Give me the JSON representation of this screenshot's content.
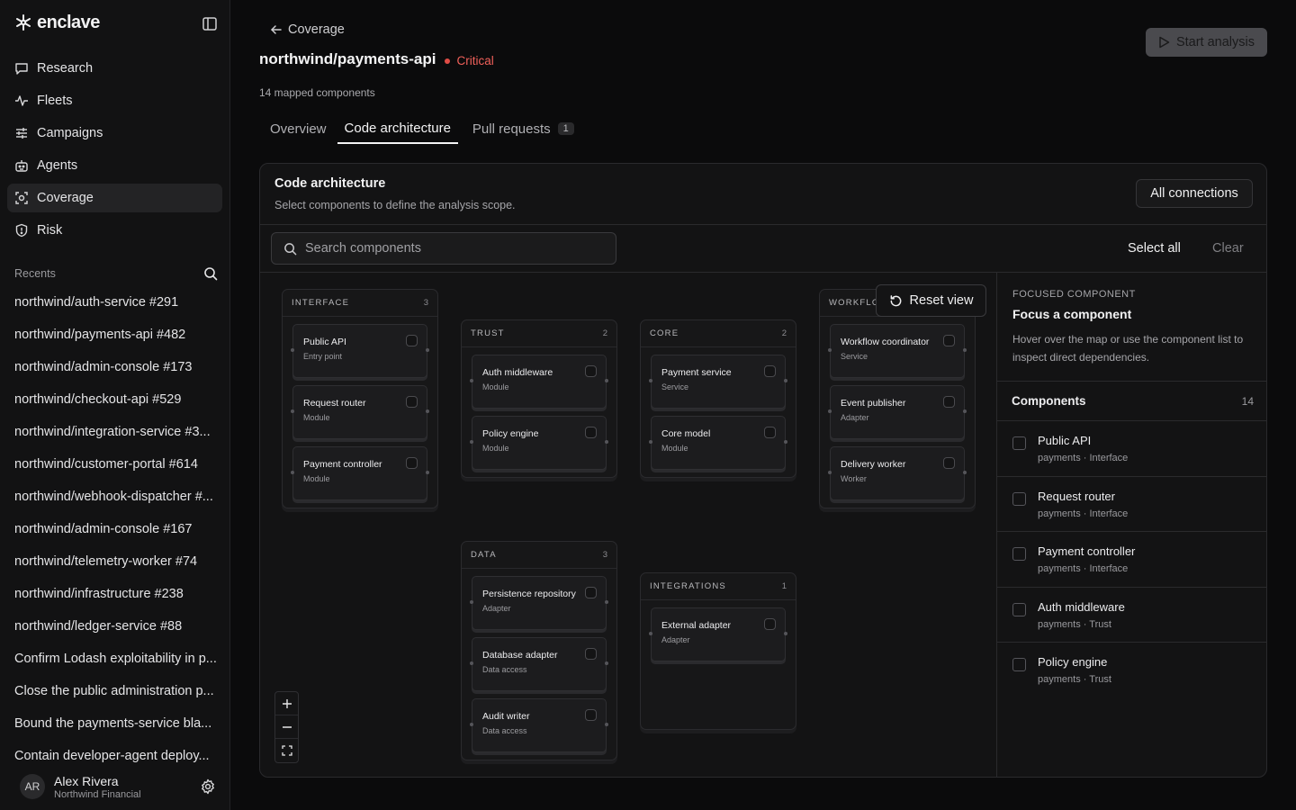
{
  "app": {
    "name": "enclave"
  },
  "nav": [
    {
      "label": "Research",
      "icon": "chat-bubble-icon"
    },
    {
      "label": "Fleets",
      "icon": "activity-icon"
    },
    {
      "label": "Campaigns",
      "icon": "sliders-icon"
    },
    {
      "label": "Agents",
      "icon": "robot-icon"
    },
    {
      "label": "Coverage",
      "icon": "scan-icon",
      "active": true
    },
    {
      "label": "Risk",
      "icon": "shield-icon"
    }
  ],
  "recents": {
    "label": "Recents",
    "items": [
      "northwind/auth-service #291",
      "northwind/payments-api #482",
      "northwind/admin-console #173",
      "northwind/checkout-api #529",
      "northwind/integration-service #3...",
      "northwind/customer-portal #614",
      "northwind/webhook-dispatcher #...",
      "northwind/admin-console #167",
      "northwind/telemetry-worker #74",
      "northwind/infrastructure #238",
      "northwind/ledger-service #88",
      "Confirm Lodash exploitability in p...",
      "Close the public administration p...",
      "Bound the payments-service bla...",
      "Contain developer-agent deploy..."
    ]
  },
  "user": {
    "initials": "AR",
    "name": "Alex Rivera",
    "org": "Northwind Financial"
  },
  "header": {
    "back_label": "Coverage",
    "repo": "northwind/payments-api",
    "severity": "Critical",
    "mapped": "14 mapped components",
    "start_button": "Start analysis"
  },
  "tabs": [
    {
      "label": "Overview"
    },
    {
      "label": "Code architecture",
      "active": true
    },
    {
      "label": "Pull requests",
      "badge": "1"
    }
  ],
  "panel": {
    "title": "Code architecture",
    "subtitle": "Select components to define the analysis scope.",
    "all_connections": "All connections",
    "search_placeholder": "Search components",
    "select_all": "Select all",
    "clear": "Clear",
    "reset_view": "Reset view"
  },
  "groups": {
    "interface": {
      "name": "INTERFACE",
      "count": "3",
      "nodes": [
        {
          "title": "Public API",
          "type": "Entry point"
        },
        {
          "title": "Request router",
          "type": "Module"
        },
        {
          "title": "Payment controller",
          "type": "Module"
        }
      ]
    },
    "trust": {
      "name": "TRUST",
      "count": "2",
      "nodes": [
        {
          "title": "Auth middleware",
          "type": "Module"
        },
        {
          "title": "Policy engine",
          "type": "Module"
        }
      ]
    },
    "core": {
      "name": "CORE",
      "count": "2",
      "nodes": [
        {
          "title": "Payment service",
          "type": "Service"
        },
        {
          "title": "Core model",
          "type": "Module"
        }
      ]
    },
    "workflow": {
      "name": "WORKFLOW",
      "nodes": [
        {
          "title": "Workflow coordinator",
          "type": "Service"
        },
        {
          "title": "Event publisher",
          "type": "Adapter"
        },
        {
          "title": "Delivery worker",
          "type": "Worker"
        }
      ]
    },
    "data": {
      "name": "DATA",
      "count": "3",
      "nodes": [
        {
          "title": "Persistence repository",
          "type": "Adapter"
        },
        {
          "title": "Database adapter",
          "type": "Data access"
        },
        {
          "title": "Audit writer",
          "type": "Data access"
        }
      ]
    },
    "integrations": {
      "name": "INTEGRATIONS",
      "count": "1",
      "nodes": [
        {
          "title": "External adapter",
          "type": "Adapter"
        }
      ]
    }
  },
  "focus": {
    "label": "FOCUSED COMPONENT",
    "title": "Focus a component",
    "description": "Hover over the map or use the component list to inspect direct dependencies."
  },
  "components": {
    "title": "Components",
    "count": "14",
    "items": [
      {
        "name": "Public API",
        "sub": "payments · Interface"
      },
      {
        "name": "Request router",
        "sub": "payments · Interface"
      },
      {
        "name": "Payment controller",
        "sub": "payments · Interface"
      },
      {
        "name": "Auth middleware",
        "sub": "payments · Trust"
      },
      {
        "name": "Policy engine",
        "sub": "payments · Trust"
      }
    ]
  },
  "colors": {
    "critical": "#e04c46",
    "background": "#0b0b0c",
    "panel": "#131314"
  }
}
